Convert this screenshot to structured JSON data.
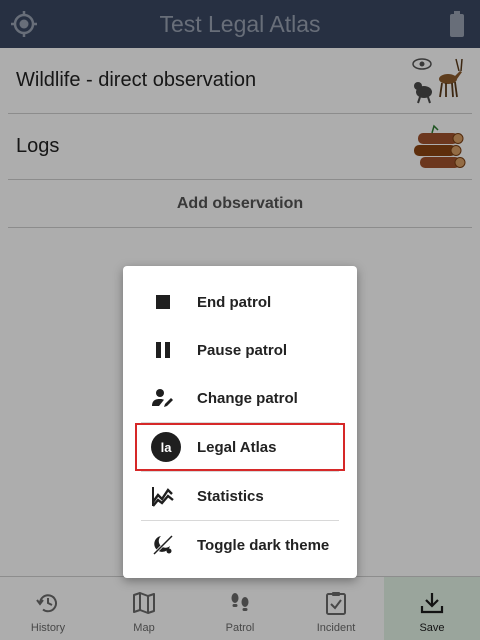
{
  "header": {
    "title": "Test Legal Atlas",
    "locate_icon": "crosshair-location-icon",
    "battery_icon": "battery-icon"
  },
  "list": {
    "items": [
      {
        "label": "Wildlife - direct observation",
        "icon": "wildlife-icon"
      },
      {
        "label": "Logs",
        "icon": "logs-icon"
      }
    ],
    "add_label": "Add observation"
  },
  "menu": {
    "items": [
      {
        "label": "End patrol",
        "icon": "stop-icon"
      },
      {
        "label": "Pause patrol",
        "icon": "pause-icon"
      },
      {
        "label": "Change patrol",
        "icon": "person-edit-icon"
      },
      {
        "label": "Legal Atlas",
        "icon": "legal-atlas-logo",
        "highlighted": true
      },
      {
        "label": "Statistics",
        "icon": "statistics-chart-icon"
      },
      {
        "label": "Toggle dark theme",
        "icon": "theme-toggle-icon"
      }
    ]
  },
  "bottom_nav": {
    "items": [
      {
        "label": "History",
        "icon": "history-icon"
      },
      {
        "label": "Map",
        "icon": "map-icon"
      },
      {
        "label": "Patrol",
        "icon": "footsteps-icon"
      },
      {
        "label": "Incident",
        "icon": "clipboard-check-icon"
      },
      {
        "label": "Save",
        "icon": "download-icon",
        "active": true
      }
    ]
  },
  "colors": {
    "header_bg": "#3a4862",
    "save_bg": "#e3f3e6",
    "highlight_border": "#d62828"
  },
  "logo_text": "la"
}
